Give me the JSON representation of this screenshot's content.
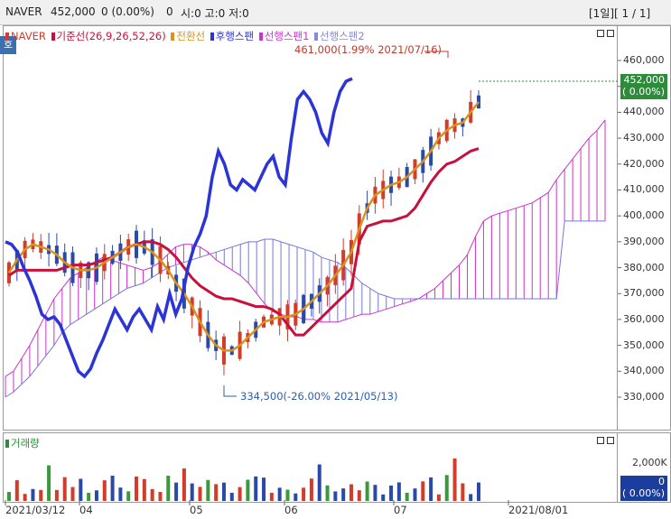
{
  "titlebar": {
    "symbol": "NAVER",
    "price": "452,000",
    "change": "0 (0.00%)",
    "vol": "0",
    "ohlc": "시:0 고:0 저:0",
    "pager": "[1일][ 1 / 1]"
  },
  "panel_badge": "호",
  "legend": {
    "naver": "NAVER",
    "base": "기준선(26,9,26,52,26)",
    "conv": "전환선",
    "lag": "후행스팬",
    "lead1": "선행스팬1",
    "lead2": "선행스팬2"
  },
  "annotations": {
    "high": "461,000(1.99% 2021/07/16)",
    "low": "334,500(-26.00% 2021/05/13)"
  },
  "price_tag": {
    "value": "452,000",
    "pct": "( 0.00%)"
  },
  "y_axis": [
    "460,000",
    "450,000",
    "440,000",
    "430,000",
    "420,000",
    "410,000",
    "400,000",
    "390,000",
    "380,000",
    "370,000",
    "360,000",
    "350,000",
    "340,000",
    "330,000"
  ],
  "volume": {
    "label": "거래량",
    "axis": "2,000K",
    "tag_value": "0",
    "tag_pct": "( 0.00%)"
  },
  "x_axis": [
    "2021/03/12",
    "04",
    "05",
    "06",
    "07",
    "2021/08/01"
  ],
  "colors": {
    "up": "#d23c2a",
    "down": "#2a4aa8",
    "base": "#c8103c",
    "conv": "#d9921e",
    "lag": "#2b35d6",
    "cloud": "#cc33cc",
    "cloud2": "#7777dd",
    "tag": "#2e8b3a",
    "voltag": "#1a3d9e"
  },
  "chart_data": {
    "type": "candlestick_ichimoku",
    "symbol": "NAVER",
    "y_range": [
      325000,
      468000
    ],
    "high": {
      "value": 461000,
      "date": "2021/07/16"
    },
    "low": {
      "value": 334500,
      "date": "2021/05/13"
    },
    "last_close": 452000,
    "conv": [
      378000,
      383000,
      387000,
      389000,
      388000,
      387000,
      385000,
      382000,
      380000,
      379000,
      379000,
      380000,
      382000,
      384000,
      386000,
      388000,
      389000,
      388000,
      386000,
      383000,
      379000,
      374000,
      370000,
      365000,
      359000,
      354000,
      350000,
      348000,
      348000,
      350000,
      353000,
      356000,
      359000,
      360000,
      361000,
      361000,
      362000,
      364000,
      367000,
      370000,
      373000,
      377000,
      381000,
      386000,
      395000,
      403000,
      408000,
      410000,
      412000,
      413000,
      415000,
      418000,
      421000,
      425000,
      430000,
      433000,
      435000,
      436000,
      440000,
      444000
    ],
    "base": [
      377000,
      379000,
      379000,
      379000,
      379000,
      379000,
      379000,
      380000,
      381000,
      381000,
      381000,
      382000,
      383000,
      384000,
      386000,
      388000,
      389000,
      390000,
      390000,
      389000,
      387000,
      384000,
      380000,
      376000,
      373000,
      371000,
      369000,
      368000,
      368000,
      367000,
      366000,
      365000,
      365000,
      364000,
      362000,
      358000,
      354000,
      354000,
      357000,
      360000,
      363000,
      366000,
      369000,
      372000,
      390000,
      396000,
      397000,
      398000,
      398000,
      399000,
      400000,
      403000,
      408000,
      413000,
      417000,
      420000,
      421000,
      423000,
      425000,
      426000
    ],
    "lag": [
      390000,
      389000,
      386000,
      380000,
      375000,
      369000,
      362000,
      360000,
      361000,
      358000,
      352000,
      346000,
      340000,
      338000,
      341000,
      347000,
      352000,
      358000,
      364000,
      360000,
      356000,
      361000,
      364000,
      360000,
      356000,
      365000,
      360000,
      370000,
      362000,
      368000,
      380000,
      388000,
      393000,
      400000,
      415000,
      425000,
      420000,
      412000,
      410000,
      414000,
      412000,
      410000,
      415000,
      420000,
      423000,
      415000,
      412000,
      430000,
      445000,
      448000,
      445000,
      440000,
      432000,
      428000,
      440000,
      448000,
      452000,
      453000
    ],
    "cloud": {
      "lead1": [
        338000,
        340000,
        345000,
        350000,
        356000,
        362000,
        368000,
        372000,
        376000,
        378000,
        380000,
        382000,
        384000,
        383000,
        382000,
        381000,
        380000,
        379000,
        380000,
        382000,
        385000,
        388000,
        389000,
        389000,
        388000,
        386000,
        383000,
        381000,
        379000,
        377000,
        374000,
        370000,
        366000,
        363000,
        362000,
        361000,
        361000,
        360000,
        360000,
        359000,
        359000,
        359000,
        360000,
        361000,
        362000,
        362000,
        363000,
        364000,
        365000,
        366000,
        367000,
        368000,
        370000,
        372000,
        375000,
        378000,
        381000,
        385000,
        392000,
        398000,
        400000,
        401000,
        402000,
        403000,
        404000,
        405000,
        407000,
        409000,
        414000,
        418000,
        422000,
        426000,
        430000,
        433000,
        437000
      ],
      "lead2": [
        330000,
        332000,
        335000,
        338000,
        342000,
        346000,
        350000,
        355000,
        358000,
        360000,
        362000,
        364000,
        366000,
        368000,
        370000,
        372000,
        373000,
        374000,
        376000,
        378000,
        380000,
        381000,
        382000,
        383000,
        384000,
        385000,
        386000,
        387000,
        388000,
        389000,
        390000,
        390000,
        391000,
        391000,
        390000,
        389000,
        388000,
        387000,
        386000,
        384000,
        383000,
        382000,
        380000,
        377000,
        374000,
        372000,
        370000,
        369000,
        368000,
        368000,
        368000,
        368000,
        368000,
        368000,
        368000,
        368000,
        368000,
        368000,
        368000,
        368000,
        368000,
        368000,
        368000,
        368000,
        368000,
        368000,
        368000,
        368000,
        368000,
        398000,
        398000,
        398000,
        398000,
        398000,
        398000
      ]
    },
    "candles_note": "daily OHLC 2021/03/12 - 2021/07/23"
  }
}
